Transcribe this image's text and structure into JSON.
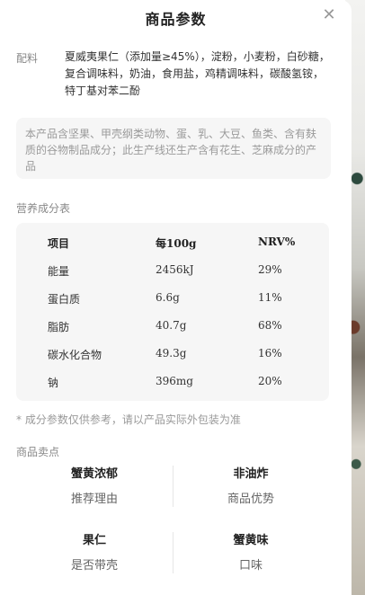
{
  "sheet": {
    "title": "商品参数",
    "close_icon": "close-icon"
  },
  "ingredients": {
    "label": "配料",
    "text": "夏威夷果仁（添加量≥45%），淀粉，小麦粉，白砂糖，复合调味料，奶油，食用盐，鸡精调味料，碳酸氢铵，特丁基对苯二酚"
  },
  "allergen_notice": "本产品含坚果、甲壳纲类动物、蛋、乳、大豆、鱼类、含有麸质的谷物制品成分；此生产线还生产含有花生、芝麻成分的产品",
  "nutrition": {
    "section_title": "营养成分表",
    "headers": [
      "项目",
      "每100g",
      "NRV%"
    ],
    "rows": [
      [
        "能量",
        "2456kJ",
        "29%"
      ],
      [
        "蛋白质",
        "6.6g",
        "11%"
      ],
      [
        "脂肪",
        "40.7g",
        "68%"
      ],
      [
        "碳水化合物",
        "49.3g",
        "16%"
      ],
      [
        "钠",
        "396mg",
        "20%"
      ]
    ]
  },
  "disclaimer": "* 成分参数仅供参考，请以产品实际外包装为准",
  "selling_points": {
    "section_title": "商品卖点",
    "items": [
      {
        "value": "蟹黄浓郁",
        "key": "推荐理由"
      },
      {
        "value": "非油炸",
        "key": "商品优势"
      },
      {
        "value": "果仁",
        "key": "是否带壳"
      },
      {
        "value": "蟹黄味",
        "key": "口味"
      }
    ]
  }
}
